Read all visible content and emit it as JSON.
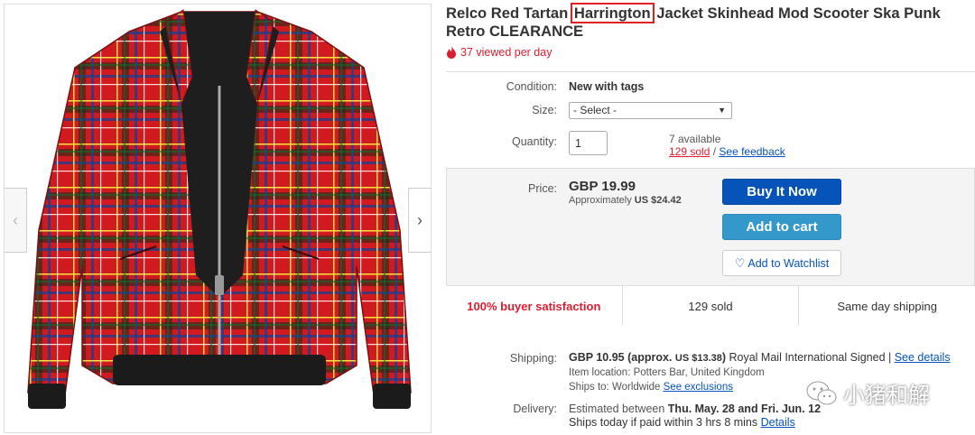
{
  "listing": {
    "title_before": "Relco Red Tartan ",
    "title_highlight": "Harrington",
    "title_after": " Jacket Skinhead Mod Scooter Ska Punk Retro CLEARANCE",
    "viewed": "37 viewed per day"
  },
  "gallery": {
    "prev_arrow": "‹",
    "next_arrow": "›"
  },
  "details": {
    "condition_label": "Condition:",
    "condition_value": "New with tags",
    "size_label": "Size:",
    "size_selected": "- Select -",
    "quantity_label": "Quantity:",
    "quantity_value": "1",
    "available": "7 available",
    "sold_link": "129 sold",
    "sold_sep": " / ",
    "feedback_link": "See feedback"
  },
  "price": {
    "label": "Price:",
    "value": "GBP 19.99",
    "approx_prefix": "Approximately ",
    "approx_value": "US $24.42",
    "buy_now": "Buy It Now",
    "add_to_cart": "Add to cart",
    "watchlist": "Add to Watchlist"
  },
  "stats": [
    "100% buyer satisfaction",
    "129 sold",
    "Same day shipping"
  ],
  "shipping": {
    "label": "Shipping:",
    "cost": "GBP 10.95 (approx. ",
    "cost_usd": "US $13.38",
    "cost_close": ")",
    "method": "  Royal Mail International Signed | ",
    "see_details": "See details",
    "location": "Item location:  Potters Bar, United Kingdom",
    "ships_to_prefix": "Ships to:  Worldwide   ",
    "see_exclusions": "See exclusions"
  },
  "delivery": {
    "label": "Delivery:",
    "line1_prefix": "Estimated between ",
    "line1_dates": "Thu. May. 28 and Fri. Jun. 12",
    "line2_prefix": "Ships today if paid within 3 hrs 8 mins ",
    "details_link": "Details"
  },
  "watermark": {
    "text": "小猪和解"
  },
  "colors": {
    "accent_blue": "#0654ba",
    "cart_blue": "#3498ca",
    "alert_red": "#dd1e31",
    "highlight_box": "#e02020",
    "tartan_red": "#d11a1f"
  },
  "icons": [
    "flame-icon",
    "heart-icon",
    "chevron-left-icon",
    "chevron-right-icon",
    "dropdown-caret-icon",
    "wechat-logo-icon"
  ]
}
